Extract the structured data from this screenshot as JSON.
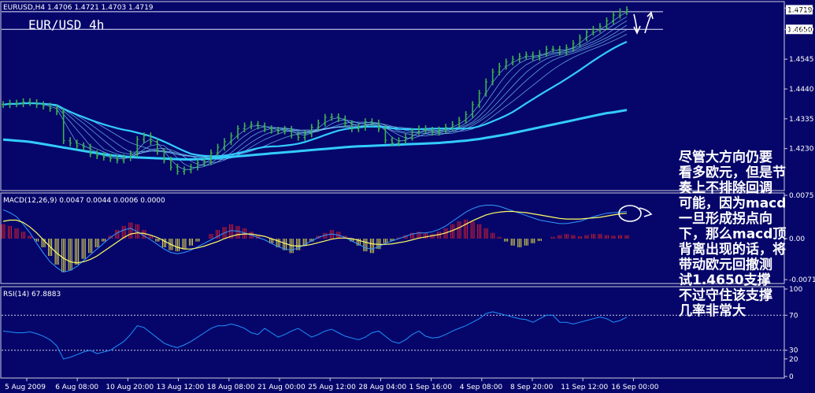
{
  "chart_data": {
    "type": "line",
    "symbol_header": "EURUSD,H4  1.4706 1.4721 1.4703 1.4719",
    "watermark": "EUR/USD 4h",
    "x_labels": [
      "5 Aug 2009",
      "6 Aug 08:00",
      "10 Aug 20:00",
      "13 Aug 12:00",
      "18 Aug 08:00",
      "21 Aug 00:00",
      "25 Aug 12:00",
      "28 Aug 04:00",
      "1 Sep 16:00",
      "4 Sep 08:00",
      "8 Sep 20:00",
      "11 Sep 12:00",
      "16 Sep 00:00"
    ],
    "price_panel": {
      "y_ticks": [
        "1.4725",
        "1.4650",
        "1.4545",
        "1.4440",
        "1.4335",
        "1.4230"
      ],
      "ylim": [
        1.4085,
        1.4745
      ],
      "support_level": 1.465,
      "upper_level": 1.4712,
      "current_price": "1.4719",
      "close_series": [
        1.4385,
        1.439,
        1.4388,
        1.4395,
        1.4392,
        1.4385,
        1.438,
        1.4372,
        1.436,
        1.4258,
        1.425,
        1.424,
        1.4235,
        1.4212,
        1.4205,
        1.42,
        1.4195,
        1.419,
        1.4198,
        1.4212,
        1.4262,
        1.4275,
        1.4255,
        1.422,
        1.419,
        1.4165,
        1.415,
        1.4155,
        1.4165,
        1.418,
        1.4185,
        1.4215,
        1.4235,
        1.4255,
        1.4275,
        1.43,
        1.431,
        1.4315,
        1.431,
        1.43,
        1.4295,
        1.4292,
        1.4298,
        1.4278,
        1.427,
        1.4282,
        1.4305,
        1.432,
        1.434,
        1.4342,
        1.4335,
        1.4318,
        1.43,
        1.4305,
        1.4325,
        1.432,
        1.43,
        1.426,
        1.425,
        1.4258,
        1.427,
        1.429,
        1.43,
        1.4295,
        1.4288,
        1.4296,
        1.4305,
        1.4315,
        1.433,
        1.435,
        1.4385,
        1.4425,
        1.4465,
        1.45,
        1.452,
        1.4535,
        1.4545,
        1.4555,
        1.456,
        1.4552,
        1.4565,
        1.458,
        1.458,
        1.457,
        1.4585,
        1.46,
        1.462,
        1.464,
        1.465,
        1.466,
        1.468,
        1.47,
        1.4712,
        1.4719
      ],
      "ma_slow": [
        1.4262,
        1.426,
        1.4258,
        1.4256,
        1.4254,
        1.425,
        1.4246,
        1.4242,
        1.4238,
        1.4234,
        1.423,
        1.4226,
        1.4222,
        1.4218,
        1.4214,
        1.421,
        1.4207,
        1.4204,
        1.4202,
        1.42,
        1.4199,
        1.4198,
        1.4197,
        1.4196,
        1.4195,
        1.4194,
        1.4193,
        1.4192,
        1.4192,
        1.4193,
        1.4194,
        1.4195,
        1.4197,
        1.4199,
        1.4201,
        1.4203,
        1.4205,
        1.4207,
        1.4209,
        1.4211,
        1.4213,
        1.4215,
        1.4217,
        1.4219,
        1.4221,
        1.4223,
        1.4225,
        1.4227,
        1.4229,
        1.4231,
        1.4233,
        1.4235,
        1.4237,
        1.4238,
        1.4239,
        1.424,
        1.4241,
        1.4242,
        1.4243,
        1.4244,
        1.4245,
        1.4246,
        1.4247,
        1.4248,
        1.4249,
        1.425,
        1.4252,
        1.4254,
        1.4256,
        1.4258,
        1.4261,
        1.4264,
        1.4268,
        1.4272,
        1.4276,
        1.428,
        1.4285,
        1.429,
        1.4295,
        1.43,
        1.4305,
        1.431,
        1.4315,
        1.432,
        1.4325,
        1.433,
        1.4335,
        1.434,
        1.4345,
        1.435,
        1.4355,
        1.4358,
        1.4362,
        1.4366
      ]
    },
    "macd_panel": {
      "header": "MACD(12,26,9) 0.0047 0.0044 0.0006 0.0000",
      "y_ticks": [
        "0.0075",
        "0.00",
        "-0.0071"
      ],
      "ylim": [
        -0.0075,
        0.0075
      ],
      "histogram": [
        0.0025,
        0.0022,
        0.0018,
        0.0012,
        0.0005,
        -0.0005,
        -0.0015,
        -0.003,
        -0.0045,
        -0.0058,
        -0.0055,
        -0.0045,
        -0.0035,
        -0.0025,
        -0.0015,
        -0.0005,
        0.0005,
        0.0015,
        0.0022,
        0.0028,
        0.0025,
        0.0015,
        0.0005,
        -0.0005,
        -0.0015,
        -0.002,
        -0.0022,
        -0.0018,
        -0.0012,
        -0.0005,
        0.0,
        0.0008,
        0.0015,
        0.002,
        0.0025,
        0.0022,
        0.0018,
        0.0012,
        0.0006,
        0.0,
        -0.0008,
        -0.0015,
        -0.002,
        -0.0025,
        -0.002,
        -0.0012,
        -0.0005,
        0.0005,
        0.001,
        0.0015,
        0.0012,
        0.0005,
        -0.0005,
        -0.0012,
        -0.0022,
        -0.0025,
        -0.0018,
        -0.0008,
        -0.0004,
        0.0002,
        0.0006,
        0.001,
        0.0012,
        0.001,
        0.0008,
        0.0012,
        0.0018,
        0.0025,
        0.003,
        0.0033,
        0.003,
        0.0025,
        0.0018,
        0.001,
        0.0003,
        -0.0005,
        -0.0012,
        -0.0015,
        -0.0012,
        -0.0008,
        -0.0004,
        0.0,
        0.0003,
        0.0006,
        0.0008,
        0.0006,
        0.0004,
        0.0006,
        0.0008,
        0.0008,
        0.0006,
        0.0005,
        0.0006,
        0.0006
      ],
      "macd_line": [
        0.005,
        0.0045,
        0.0038,
        0.0025,
        0.001,
        -0.0008,
        -0.0025,
        -0.004,
        -0.005,
        -0.0058,
        -0.0055,
        -0.0048,
        -0.0038,
        -0.0028,
        -0.0018,
        -0.0008,
        0.0002,
        0.001,
        0.0015,
        0.0018,
        0.0012,
        0.0005,
        -0.0002,
        -0.001,
        -0.0018,
        -0.0024,
        -0.0026,
        -0.0024,
        -0.002,
        -0.0014,
        -0.0008,
        -0.0002,
        0.0004,
        0.001,
        0.0014,
        0.0013,
        0.001,
        0.0006,
        0.0002,
        -0.0002,
        -0.0008,
        -0.0014,
        -0.0018,
        -0.002,
        -0.0016,
        -0.001,
        -0.0004,
        0.0002,
        0.0006,
        0.0008,
        0.0006,
        0.0002,
        -0.0004,
        -0.001,
        -0.0016,
        -0.0018,
        -0.0014,
        -0.0008,
        -0.0004,
        0.0,
        0.0004,
        0.0008,
        0.001,
        0.001,
        0.0012,
        0.0016,
        0.0022,
        0.003,
        0.0038,
        0.0046,
        0.0052,
        0.0056,
        0.0058,
        0.0058,
        0.0056,
        0.0052,
        0.0048,
        0.0044,
        0.004,
        0.0036,
        0.0032,
        0.003,
        0.0028,
        0.0026,
        0.0026,
        0.0028,
        0.003,
        0.0034,
        0.0038,
        0.0041,
        0.0044,
        0.0045,
        0.0046,
        0.0047
      ],
      "signal_line": [
        0.003,
        0.0032,
        0.0032,
        0.0028,
        0.002,
        0.001,
        -0.0002,
        -0.0014,
        -0.0025,
        -0.0034,
        -0.004,
        -0.0042,
        -0.004,
        -0.0036,
        -0.003,
        -0.0022,
        -0.0014,
        -0.0006,
        0.0002,
        0.0008,
        0.001,
        0.0009,
        0.0006,
        0.0002,
        -0.0004,
        -0.001,
        -0.0015,
        -0.0018,
        -0.0018,
        -0.0016,
        -0.0013,
        -0.0009,
        -0.0005,
        0.0,
        0.0004,
        0.0007,
        0.0008,
        0.0008,
        0.0006,
        0.0004,
        0.0,
        -0.0004,
        -0.0008,
        -0.0012,
        -0.0013,
        -0.0012,
        -0.001,
        -0.0007,
        -0.0004,
        -0.0001,
        0.0001,
        0.0001,
        0.0,
        -0.0003,
        -0.0006,
        -0.0009,
        -0.001,
        -0.001,
        -0.0009,
        -0.0007,
        -0.0005,
        -0.0002,
        0.0001,
        0.0003,
        0.0005,
        0.0007,
        0.001,
        0.0014,
        0.0019,
        0.0025,
        0.0031,
        0.0036,
        0.0041,
        0.0044,
        0.0046,
        0.0047,
        0.0047,
        0.0046,
        0.0045,
        0.0043,
        0.0041,
        0.0039,
        0.0037,
        0.0035,
        0.0034,
        0.0034,
        0.0034,
        0.0035,
        0.0036,
        0.0037,
        0.0039,
        0.0041,
        0.0043,
        0.0044
      ]
    },
    "rsi_panel": {
      "header": "RSI(14) 67.8883",
      "y_ticks": [
        "100",
        "70",
        "30",
        "20",
        "0"
      ],
      "ylim": [
        0,
        100
      ],
      "levels": [
        70,
        30
      ],
      "values": [
        52,
        51,
        50,
        50,
        51,
        49,
        46,
        42,
        35,
        20,
        22,
        25,
        28,
        30,
        26,
        28,
        30,
        35,
        40,
        48,
        58,
        56,
        50,
        44,
        38,
        35,
        33,
        36,
        40,
        45,
        50,
        55,
        58,
        58,
        60,
        58,
        55,
        50,
        48,
        55,
        50,
        45,
        48,
        52,
        55,
        50,
        45,
        48,
        52,
        54,
        50,
        46,
        44,
        42,
        45,
        50,
        52,
        46,
        40,
        38,
        42,
        48,
        52,
        46,
        44,
        45,
        48,
        52,
        55,
        58,
        62,
        66,
        72,
        74,
        72,
        70,
        68,
        66,
        65,
        62,
        66,
        70,
        70,
        62,
        62,
        60,
        62,
        64,
        66,
        68,
        66,
        62,
        64,
        67.9
      ]
    },
    "annotation_lines": [
      "尽管大方向仍要",
      "看多欧元，但是节",
      "奏上不排除回调",
      "可能，因为macd",
      "一旦形成拐点向",
      "下，那么macd顶",
      "背离出现的话，将",
      "带动欧元回撤测",
      "试1.4650支撑",
      "不过守住该支撑",
      "几率非常大"
    ],
    "colors": {
      "background": "#06066a",
      "price_line": "#3cb44a",
      "ma_slow": "#33ccff",
      "ma_fast": "#7fd4ff",
      "hist_pos": "#d81e2a",
      "hist_neg": "#e9e34a",
      "macd_line": "#3399ff",
      "signal_line": "#ffff66",
      "rsi_line": "#1e90ff",
      "text": "#ffffff"
    }
  }
}
